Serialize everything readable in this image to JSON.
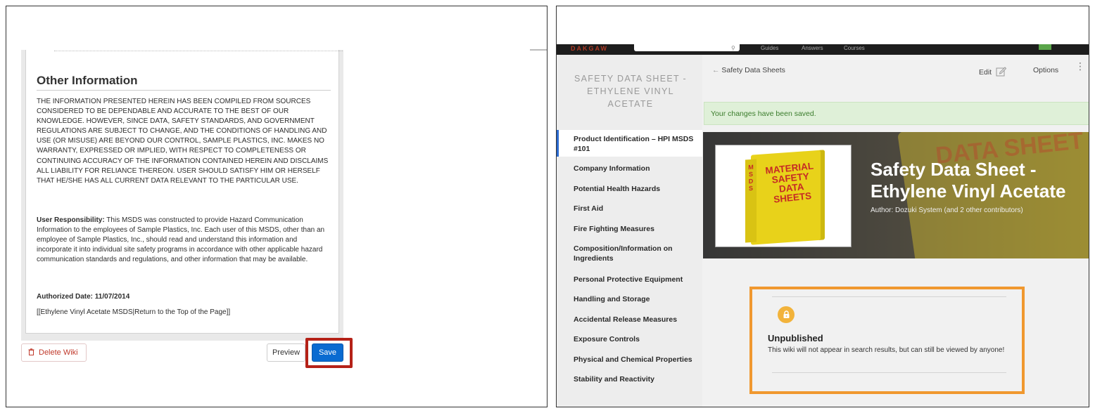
{
  "left": {
    "section_heading": "Other Information",
    "paragraph_1": "THE INFORMATION PRESENTED HEREIN HAS BEEN COMPILED FROM SOURCES CONSIDERED TO BE DEPENDABLE AND ACCURATE TO THE BEST OF OUR KNOWLEDGE. HOWEVER, SINCE DATA, SAFETY STANDARDS, AND GOVERNMENT REGULATIONS ARE SUBJECT TO CHANGE, AND THE CONDITIONS OF HANDLING AND USE (OR MISUSE) ARE BEYOND OUR CONTROL, SAMPLE PLASTICS, INC. MAKES NO WARRANTY, EXPRESSED OR IMPLIED, WITH RESPECT TO COMPLETENESS OR CONTINUING ACCURACY OF THE INFORMATION CONTAINED HEREIN AND DISCLAIMS ALL LIABILITY FOR RELIANCE THEREON. USER SHOULD SATISFY HIM OR HERSELF THAT HE/SHE HAS ALL CURRENT DATA RELEVANT TO THE PARTICULAR USE.",
    "user_resp_label": "User Responsibility:",
    "user_resp_text": " This MSDS was constructed to provide Hazard Communication Information to the employees of Sample Plastics, Inc. Each user of this MSDS, other than an employee of Sample Plastics, Inc., should read and understand this information and incorporate it into individual site safety programs in accordance with other applicable hazard communication standards and regulations, and other information that may be available.",
    "authorized_date": "Authorized Date: 11/07/2014",
    "wiki_link": "[[Ethylene Vinyl Acetate MSDS|Return to the Top of the Page]]",
    "delete_label": "Delete Wiki",
    "preview_label": "Preview",
    "save_label": "Save",
    "highlight_color": "#b52218"
  },
  "right": {
    "topbar": {
      "logo": "DAKGAW",
      "links": [
        "Guides",
        "Answers",
        "Courses"
      ]
    },
    "sidebar": {
      "title": "SAFETY DATA SHEET - ETHYLENE VINYL ACETATE",
      "items": [
        "Product Identification – HPI MSDS #101",
        "Company Information",
        "Potential Health Hazards",
        "First Aid",
        "Fire Fighting Measures",
        "Composition/Information on Ingredients",
        "Personal Protective Equipment",
        "Handling and Storage",
        "Accidental Release Measures",
        "Exposure Controls",
        "Physical and Chemical Properties",
        "Stability and Reactivity"
      ],
      "active_index": 0
    },
    "breadcrumb": "Safety Data Sheets",
    "edit_label": "Edit",
    "options_label": "Options",
    "saved_message": "Your changes have been saved.",
    "hero": {
      "title": "Safety Data Sheet - Ethylene Vinyl Acetate",
      "author": "Author: Dozuki System (and 2 other contributors)",
      "image_text": "MATERIAL SAFETY DATA SHEETS",
      "spine_text": "MSDS",
      "background_text": "DATA SHEET"
    },
    "unpublished": {
      "title": "Unpublished",
      "text": "This wiki will not appear in search results, but can still be viewed by anyone!",
      "highlight_color": "#f0982f"
    }
  }
}
